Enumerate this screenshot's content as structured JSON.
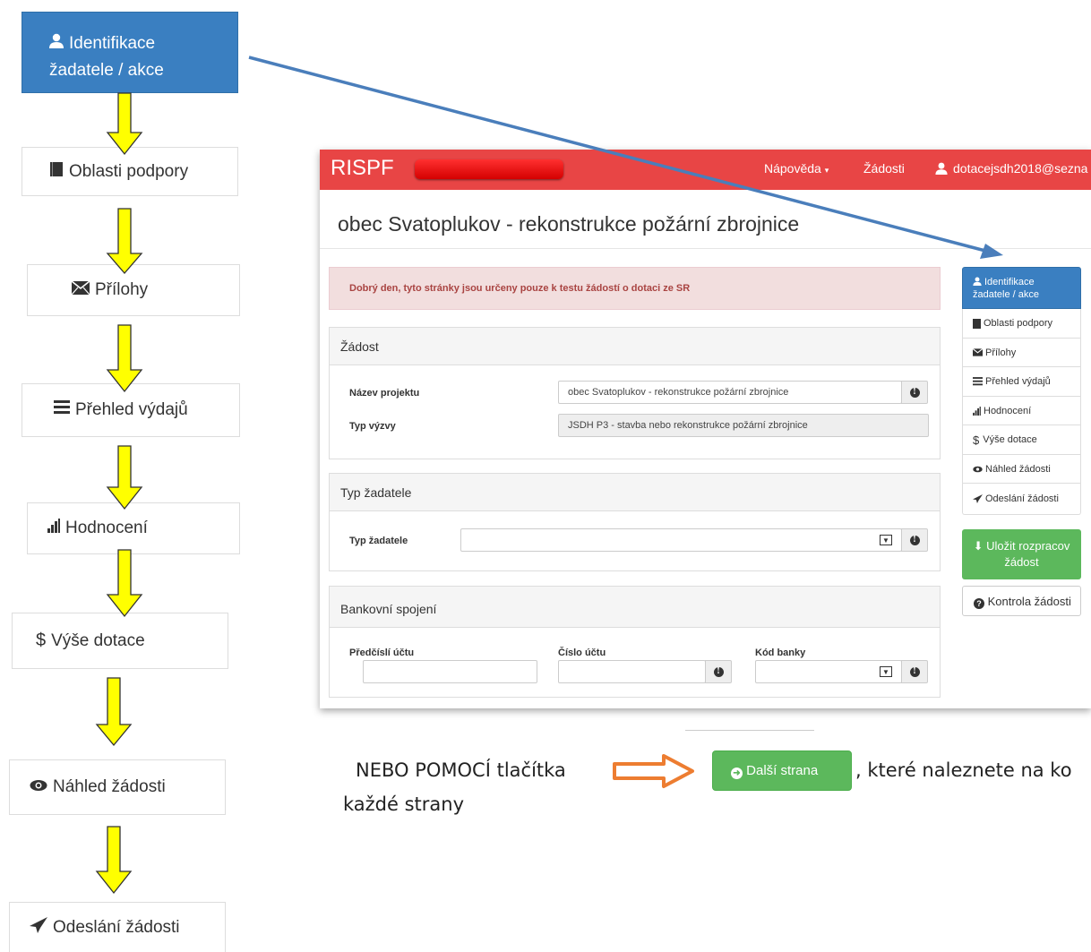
{
  "steps": [
    {
      "icon": "user-icon",
      "label_line1": "Identifikace",
      "label_line2": "žadatele / akce",
      "active": true
    },
    {
      "icon": "book-icon",
      "label": "Oblasti podpory"
    },
    {
      "icon": "envelope-icon",
      "label": "Přílohy"
    },
    {
      "icon": "list-icon",
      "label": "Přehled výdajů"
    },
    {
      "icon": "signal-icon",
      "label": "Hodnocení"
    },
    {
      "icon": "dollar-icon",
      "label": "Výše dotace"
    },
    {
      "icon": "eye-icon",
      "label": "Náhled žádosti"
    },
    {
      "icon": "send-icon",
      "label": "Odeslání žádosti"
    }
  ],
  "app": {
    "brand": "RISPF",
    "nav_help": "Nápověda",
    "nav_requests": "Žádosti",
    "nav_user": "dotacejsdh2018@sezna",
    "page_title": "obec Svatoplukov - rekonstrukce požární zbrojnice",
    "alert": "Dobrý den, tyto stránky jsou určeny pouze k testu žádostí o dotaci ze SR",
    "zadost": {
      "heading": "Žádost",
      "project_name_label": "Název projektu",
      "project_name_value": "obec Svatoplukov - rekonstrukce požární zbrojnice",
      "call_type_label": "Typ výzvy",
      "call_type_value": "JSDH P3 - stavba nebo rekonstrukce požární zbrojnice"
    },
    "applicant": {
      "heading": "Typ žadatele",
      "type_label": "Typ žadatele",
      "type_value": ""
    },
    "bank": {
      "heading": "Bankovní spojení",
      "prefix_label": "Předčíslí účtu",
      "account_label": "Číslo účtu",
      "bank_code_label": "Kód banky",
      "prefix_value": "",
      "account_value": "",
      "bank_code_value": ""
    },
    "side_menu": [
      {
        "label_line1": "Identifikace",
        "label_line2": "žadatele / akce"
      },
      {
        "label": "Oblasti podpory"
      },
      {
        "label": "Přílohy"
      },
      {
        "label": "Přehled výdajů"
      },
      {
        "label": "Hodnocení"
      },
      {
        "label": "Výše dotace"
      },
      {
        "label": "Náhled žádosti"
      },
      {
        "label": "Odeslání žádosti"
      }
    ],
    "save_button_line1": "Uložit rozpracov",
    "save_button_line2": "žádost",
    "check_button": "Kontrola žádosti"
  },
  "footer_note": {
    "text_before": "NEBO POMOCÍ tlačítka",
    "button_label": "Další strana",
    "text_after": ", které naleznete na ko",
    "text_line2": "každé strany"
  },
  "colors": {
    "active_blue": "#3a7fc1",
    "header_red": "#e84545",
    "green": "#5cb85c",
    "arrow_yellow": "#ffff00",
    "arrow_orange": "#ed7d31",
    "pointer_blue": "#4a7ebb"
  }
}
